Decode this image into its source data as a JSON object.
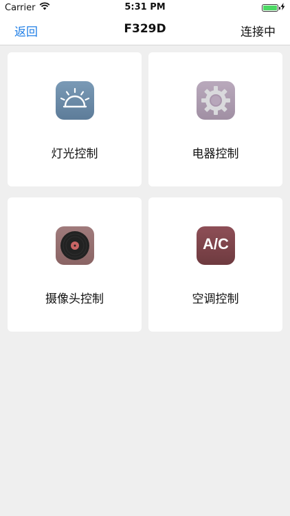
{
  "status_bar": {
    "carrier": "Carrier",
    "time": "5:31 PM",
    "battery_level": 1.0
  },
  "nav": {
    "back_label": "返回",
    "title": "F329D",
    "status_label": "连接中"
  },
  "cards": [
    {
      "label": "灯光控制",
      "icon": "lamp-light-icon",
      "color": "#6c8ca8"
    },
    {
      "label": "电器控制",
      "icon": "gear-icon",
      "color": "#ad9cb0"
    },
    {
      "label": "摄像头控制",
      "icon": "record-disc-icon",
      "color": "#956f70"
    },
    {
      "label": "空调控制",
      "icon": "air-conditioner-icon",
      "icon_text": "A/C",
      "color": "#7e454b"
    }
  ],
  "colors": {
    "accent": "#1e7ee6",
    "background": "#efefef"
  }
}
